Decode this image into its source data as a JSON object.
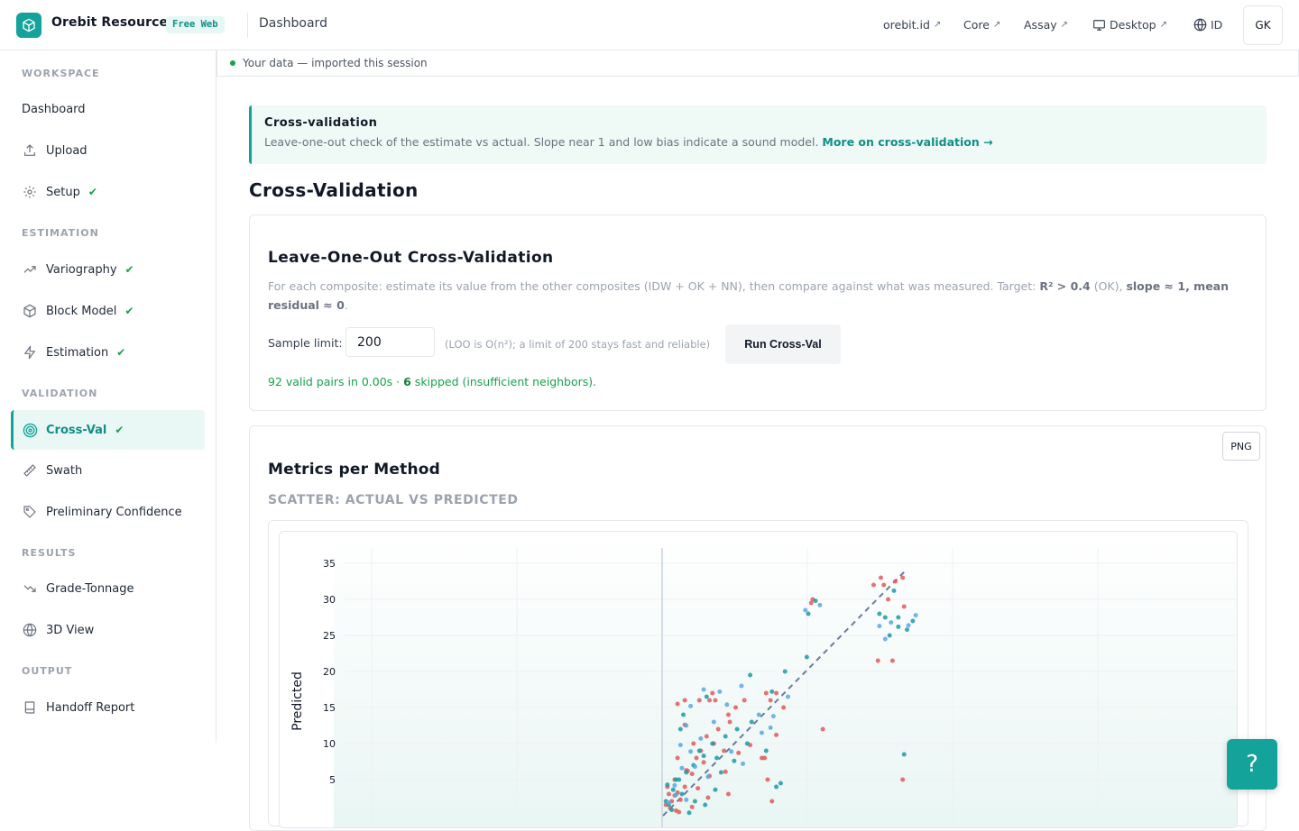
{
  "topbar": {
    "brand": "Orebit Resource",
    "badge": "Free Web",
    "breadcrumb": "Dashboard",
    "links": [
      "orebit.id",
      "Core",
      "Assay",
      "Desktop"
    ],
    "lang": "ID",
    "avatar": "GK"
  },
  "sidebar": {
    "sections": [
      {
        "title": "WORKSPACE",
        "items": [
          {
            "label": "Dashboard",
            "icon": "none",
            "done": false
          },
          {
            "label": "Upload",
            "icon": "upload-icon",
            "done": false
          },
          {
            "label": "Setup",
            "icon": "gear-icon",
            "done": true
          }
        ]
      },
      {
        "title": "ESTIMATION",
        "items": [
          {
            "label": "Variography",
            "icon": "trend-icon",
            "done": true
          },
          {
            "label": "Block Model",
            "icon": "cube-icon",
            "done": true
          },
          {
            "label": "Estimation",
            "icon": "bolt-icon",
            "done": true
          }
        ]
      },
      {
        "title": "VALIDATION",
        "items": [
          {
            "label": "Cross-Val",
            "icon": "target-icon",
            "done": true,
            "active": true
          },
          {
            "label": "Swath",
            "icon": "ruler-icon",
            "done": false
          },
          {
            "label": "Preliminary Confidence",
            "icon": "tag-icon",
            "done": false
          }
        ]
      },
      {
        "title": "RESULTS",
        "items": [
          {
            "label": "Grade-Tonnage",
            "icon": "trend-down-icon",
            "done": false
          },
          {
            "label": "3D View",
            "icon": "globe-icon",
            "done": false
          }
        ]
      },
      {
        "title": "OUTPUT",
        "items": [
          {
            "label": "Handoff Report",
            "icon": "book-icon",
            "done": false
          }
        ]
      }
    ]
  },
  "databar": {
    "text": "Your data — imported this session"
  },
  "info": {
    "title": "Cross-validation",
    "text": "Leave-one-out check of the estimate vs actual. Slope near 1 and low bias indicate a sound model. ",
    "link": "More on cross-validation →"
  },
  "page_title": "Cross-Validation",
  "loo": {
    "heading": "Leave-One-Out Cross-Validation",
    "desc_plain": "For each composite: estimate its value from the other composites (IDW + OK + NN), then compare against what was measured. Target: ",
    "desc_b1": "R² > 0.4",
    "desc_mid": " (OK), ",
    "desc_b2": "slope ≈ 1, mean residual ≈ 0",
    "desc_end": ".",
    "sample_label": "Sample limit:",
    "sample_value": "200",
    "hint": "(LOO is O(n²); a limit of 200 stays fast and reliable)",
    "run_button": "Run Cross-Val",
    "status_a": "92 valid pairs in 0.00s · ",
    "status_b": "6",
    "status_c": " skipped (insufficient neighbors)."
  },
  "metrics": {
    "heading": "Metrics per Method",
    "png_button": "PNG",
    "subheading": "SCATTER: ACTUAL VS PREDICTED"
  },
  "chart_data": {
    "type": "scatter",
    "title": "",
    "xlabel": "",
    "ylabel": "Predicted",
    "ylim": [
      0,
      36
    ],
    "y_ticks": [
      5,
      10,
      15,
      20,
      25,
      30,
      35
    ],
    "xlim": [
      -4,
      16
    ],
    "colors": {
      "red": "#e05a5a",
      "teal": "#1f9aa6",
      "blue": "#5aa8e0",
      "diag": "#6b7b9a"
    },
    "series": [
      {
        "color": "red",
        "points": [
          [
            0.2,
            1.5
          ],
          [
            0.4,
            3
          ],
          [
            0.3,
            4
          ],
          [
            0.6,
            2
          ],
          [
            0.8,
            5
          ],
          [
            1.0,
            3.2
          ],
          [
            1.2,
            2.2
          ],
          [
            1.5,
            4
          ],
          [
            1.7,
            6.2
          ],
          [
            2.0,
            5.8
          ],
          [
            2.3,
            8
          ],
          [
            2.6,
            9
          ],
          [
            2.1,
            10
          ],
          [
            1.0,
            8
          ],
          [
            3,
            11
          ],
          [
            3.5,
            10
          ],
          [
            4.2,
            9
          ],
          [
            4.5,
            14
          ],
          [
            3.8,
            12
          ],
          [
            2.5,
            16
          ],
          [
            3.2,
            16
          ],
          [
            1.5,
            16
          ],
          [
            3.6,
            16
          ],
          [
            1,
            15.5
          ],
          [
            3.4,
            17
          ],
          [
            5,
            15
          ],
          [
            7.1,
            17
          ],
          [
            7.4,
            16
          ],
          [
            7.8,
            17
          ],
          [
            8.3,
            15
          ],
          [
            5.6,
            16
          ],
          [
            7.8,
            11.2
          ],
          [
            7,
            8
          ],
          [
            6.8,
            8
          ],
          [
            7.2,
            5
          ],
          [
            7.5,
            2
          ],
          [
            10.3,
            30
          ],
          [
            10.2,
            29.5
          ],
          [
            11,
            12
          ],
          [
            15.2,
            32
          ],
          [
            14.5,
            32
          ],
          [
            15,
            33
          ],
          [
            16,
            32.5
          ],
          [
            16.5,
            33
          ],
          [
            15.5,
            30
          ],
          [
            14.8,
            21.5
          ],
          [
            15.8,
            21.5
          ],
          [
            16.5,
            5
          ],
          [
            16.6,
            29
          ],
          [
            2,
            1.2
          ],
          [
            0.5,
            1
          ],
          [
            1.1,
            0.5
          ],
          [
            0.9,
            0.7
          ],
          [
            3.1,
            2.5
          ],
          [
            4.5,
            3
          ],
          [
            1.6,
            6.3
          ],
          [
            2.8,
            7.4
          ],
          [
            4.3,
            6.1
          ],
          [
            5.2,
            8.7
          ],
          [
            6,
            9.8
          ],
          [
            1.5,
            12.6
          ],
          [
            4.6,
            13
          ],
          [
            3.2,
            5.5
          ],
          [
            2.4,
            3.8
          ],
          [
            0.8,
            2.8
          ]
        ]
      },
      {
        "color": "teal",
        "points": [
          [
            0.2,
            2
          ],
          [
            0.4,
            1.5
          ],
          [
            0.7,
            3.6
          ],
          [
            1.1,
            5
          ],
          [
            1.6,
            6
          ],
          [
            2.1,
            7
          ],
          [
            2.8,
            8.3
          ],
          [
            3.4,
            10
          ],
          [
            4.3,
            11
          ],
          [
            5.1,
            12
          ],
          [
            6.1,
            13
          ],
          [
            7.5,
            17.2
          ],
          [
            8.4,
            20
          ],
          [
            10,
            28
          ],
          [
            10.5,
            29.8
          ],
          [
            15.3,
            27.5
          ],
          [
            15.6,
            25
          ],
          [
            16.2,
            26.2
          ],
          [
            16.8,
            25.8
          ],
          [
            17.2,
            27
          ],
          [
            16.6,
            8.5
          ],
          [
            6,
            19.5
          ],
          [
            1.4,
            14
          ],
          [
            1.2,
            12
          ],
          [
            3,
            16.5
          ],
          [
            2.5,
            9
          ],
          [
            3.7,
            8
          ],
          [
            0.9,
            5
          ],
          [
            1.3,
            3
          ],
          [
            2.9,
            1.5
          ],
          [
            4,
            6
          ],
          [
            4.9,
            7.6
          ],
          [
            5.8,
            10
          ],
          [
            7.1,
            9
          ],
          [
            7.8,
            4
          ],
          [
            8.1,
            4.5
          ],
          [
            9.9,
            22
          ],
          [
            14.9,
            28
          ],
          [
            15.9,
            31.2
          ],
          [
            16.2,
            27.5
          ],
          [
            0.6,
            0.8
          ],
          [
            1.8,
            0.4
          ],
          [
            2.2,
            2
          ],
          [
            3.6,
            3.6
          ],
          [
            0.3,
            4.3
          ]
        ]
      },
      {
        "color": "blue",
        "points": [
          [
            0.4,
            1.8
          ],
          [
            0.8,
            4.2
          ],
          [
            1.3,
            6.6
          ],
          [
            1.9,
            8.9
          ],
          [
            2.6,
            10.7
          ],
          [
            3.5,
            13
          ],
          [
            4.4,
            15.4
          ],
          [
            5.4,
            18
          ],
          [
            6.6,
            14
          ],
          [
            7.4,
            12.2
          ],
          [
            8.6,
            16.5
          ],
          [
            9.8,
            28.5
          ],
          [
            10.8,
            29.2
          ],
          [
            14.9,
            26.3
          ],
          [
            15.3,
            24.5
          ],
          [
            15.7,
            26.8
          ],
          [
            16.9,
            26.4
          ],
          [
            17.4,
            27.8
          ],
          [
            2.8,
            17.5
          ],
          [
            1.6,
            12.5
          ],
          [
            1.2,
            9.8
          ],
          [
            2.2,
            6.8
          ],
          [
            3.1,
            5.4
          ],
          [
            0.9,
            2.9
          ],
          [
            1.6,
            2.2
          ],
          [
            4.7,
            8.9
          ],
          [
            5.5,
            7.2
          ],
          [
            6.8,
            11.5
          ],
          [
            7.6,
            13.8
          ],
          [
            1.9,
            15.2
          ],
          [
            3.9,
            17.2
          ]
        ]
      }
    ]
  },
  "help": {
    "label": "?"
  }
}
